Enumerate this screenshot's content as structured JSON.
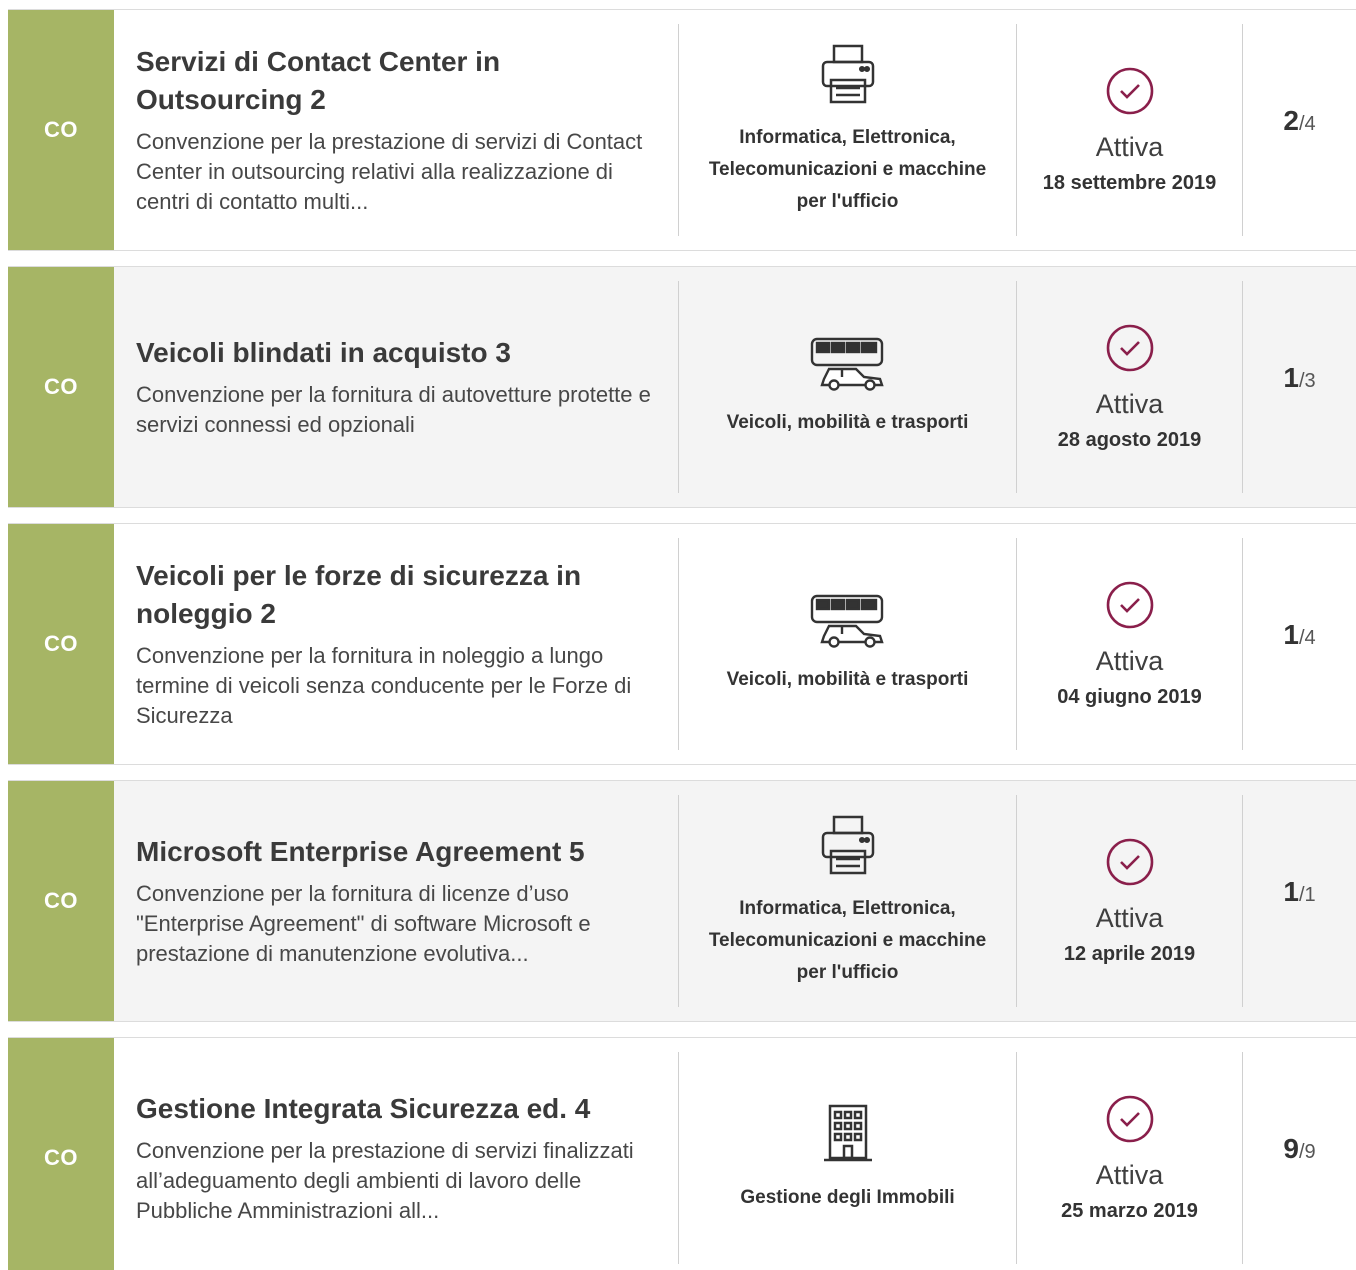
{
  "colors": {
    "type_band": "#a6b565",
    "check_accent": "#8a1f4b",
    "alt_row_bg": "#f4f4f4"
  },
  "cards": [
    {
      "type": "CO",
      "title": "Servizi di Contact Center in Outsourcing 2",
      "description": "Convenzione per la prestazione di servizi di Contact Center in outsourcing relativi alla realizzazione di centri di contatto multi...",
      "category_icon": "printer-icon",
      "category": "Informatica, Elettronica, Telecomunicazioni e macchine per l'ufficio",
      "status": "Attiva",
      "date": "18 settembre 2019",
      "lots_active": "2",
      "lots_total": "/4"
    },
    {
      "type": "CO",
      "title": "Veicoli blindati in acquisto 3",
      "description": "Convenzione per la fornitura di autovetture protette e servizi connessi ed opzionali",
      "category_icon": "vehicles-icon",
      "category": "Veicoli, mobilità e trasporti",
      "status": "Attiva",
      "date": "28 agosto 2019",
      "lots_active": "1",
      "lots_total": "/3"
    },
    {
      "type": "CO",
      "title": "Veicoli per le forze di sicurezza in noleggio 2",
      "description": "Convenzione per la fornitura in noleggio a lungo termine di veicoli senza conducente per le Forze di Sicurezza",
      "category_icon": "vehicles-icon",
      "category": "Veicoli, mobilità e trasporti",
      "status": "Attiva",
      "date": "04 giugno 2019",
      "lots_active": "1",
      "lots_total": "/4"
    },
    {
      "type": "CO",
      "title": "Microsoft Enterprise Agreement 5",
      "description": "Convenzione per la fornitura di licenze d’uso \"Enterprise Agreement\" di software Microsoft e prestazione di manutenzione evolutiva...",
      "category_icon": "printer-icon",
      "category": "Informatica, Elettronica, Telecomunicazioni e macchine per l'ufficio",
      "status": "Attiva",
      "date": "12 aprile 2019",
      "lots_active": "1",
      "lots_total": "/1"
    },
    {
      "type": "CO",
      "title": "Gestione Integrata Sicurezza ed. 4",
      "description": "Convenzione per la prestazione di servizi finalizzati all’adeguamento degli ambienti di lavoro delle Pubbliche Amministrazioni all...",
      "category_icon": "building-icon",
      "category": "Gestione degli Immobili",
      "status": "Attiva",
      "date": "25 marzo 2019",
      "lots_active": "9",
      "lots_total": "/9"
    }
  ]
}
